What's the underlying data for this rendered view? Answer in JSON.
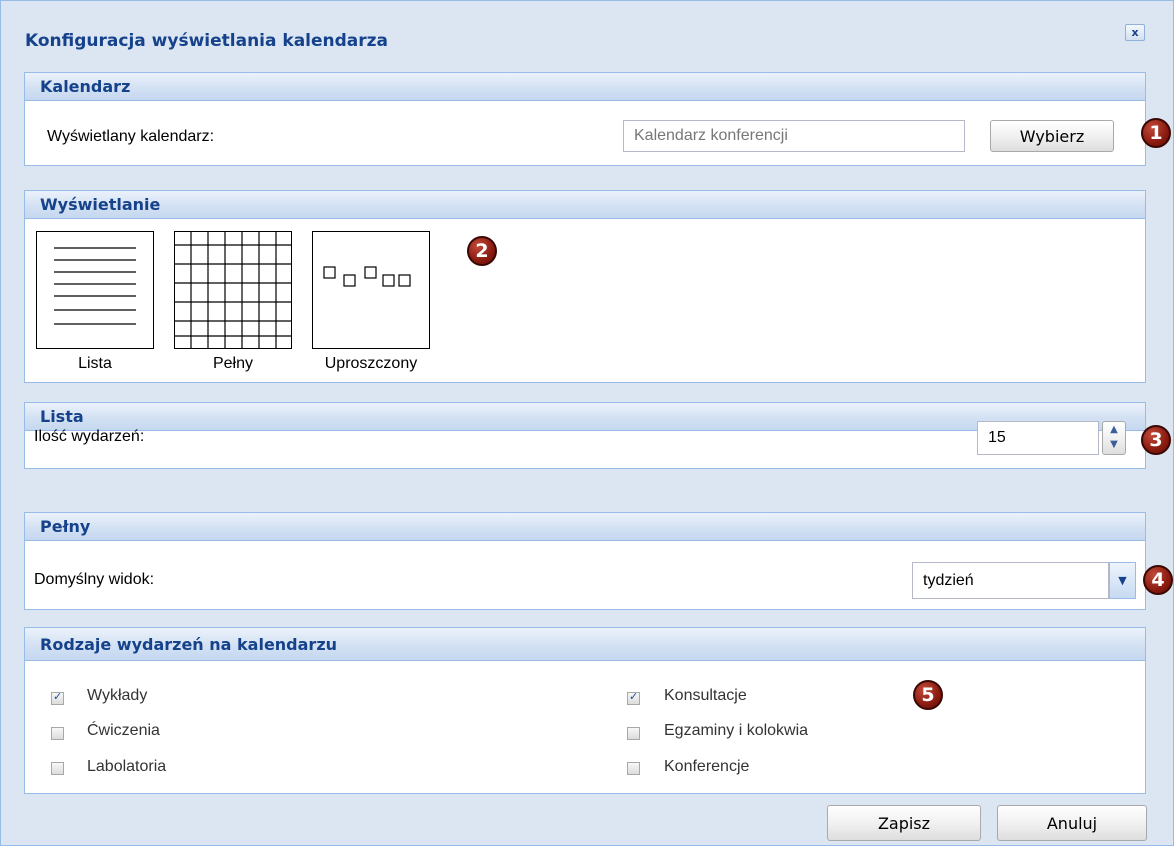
{
  "dialog": {
    "title": "Konfiguracja wyświetlania kalendarza",
    "close_label": "x"
  },
  "calendar_panel": {
    "heading": "Kalendarz",
    "label": "Wyświetlany kalendarz:",
    "input_value": "Kalendarz konferencji",
    "choose_button": "Wybierz",
    "marker": "1"
  },
  "display_panel": {
    "heading": "Wyświetlanie",
    "options": [
      {
        "label": "Lista",
        "icon": "list-layout-icon"
      },
      {
        "label": "Pełny",
        "icon": "grid-layout-icon"
      },
      {
        "label": "Uproszczony",
        "icon": "simplified-layout-icon"
      }
    ],
    "marker": "2"
  },
  "list_panel": {
    "heading": "Lista",
    "label": "Ilość wydarzeń:",
    "count_value": "15",
    "marker": "3"
  },
  "full_panel": {
    "heading": "Pełny",
    "label": "Domyślny widok:",
    "view_value": "tydzień",
    "marker": "4"
  },
  "event_types_panel": {
    "heading": "Rodzaje wydarzeń na kalendarzu",
    "checkboxes": [
      {
        "label": "Wykłady",
        "checked": true
      },
      {
        "label": "Ćwiczenia",
        "checked": false
      },
      {
        "label": "Labolatoria",
        "checked": false
      },
      {
        "label": "Konsultacje",
        "checked": true
      },
      {
        "label": "Egzaminy i kolokwia",
        "checked": false
      },
      {
        "label": "Konferencje",
        "checked": false
      }
    ],
    "marker": "5"
  },
  "footer": {
    "save_button": "Zapisz",
    "cancel_button": "Anuluj"
  },
  "colors": {
    "heading_text": "#15428b",
    "panel_border": "#99bbe8",
    "annotation": "#8a1b10"
  }
}
